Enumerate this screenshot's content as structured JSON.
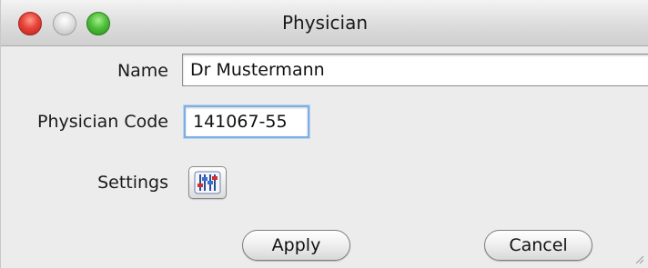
{
  "window": {
    "title": "Physician"
  },
  "form": {
    "name_label": "Name",
    "name_value": "Dr Mustermann",
    "code_label": "Physician Code",
    "code_value": "141067-55",
    "settings_label": "Settings"
  },
  "buttons": {
    "apply_label": "Apply",
    "cancel_label": "Cancel"
  },
  "icons": {
    "settings": "sliders-icon"
  }
}
